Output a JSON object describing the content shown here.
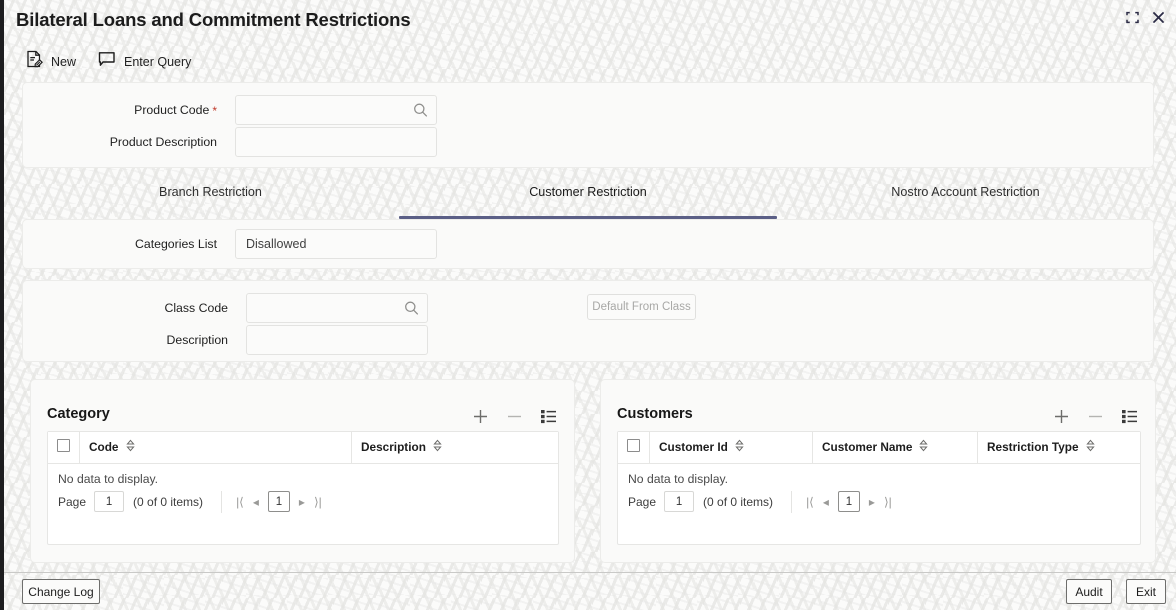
{
  "window": {
    "title": "Bilateral Loans and Commitment Restrictions",
    "restore_icon": "restore-down-icon",
    "close_icon": "close-icon"
  },
  "toolbar": {
    "items": [
      {
        "label": "New",
        "icon": "new-document-icon"
      },
      {
        "label": "Enter Query",
        "icon": "speech-bubble-icon"
      }
    ]
  },
  "product": {
    "code_label": "Product Code",
    "code_required": "*",
    "code_value": "",
    "code_lov_icon": "search-icon",
    "description_label": "Product Description",
    "description_value": ""
  },
  "tabs": [
    {
      "label": "Branch Restriction",
      "active": false
    },
    {
      "label": "Customer Restriction",
      "active": true
    },
    {
      "label": "Nostro Account Restriction",
      "active": false
    }
  ],
  "categories_list": {
    "label": "Categories List",
    "value": "Disallowed"
  },
  "class_section": {
    "class_code_label": "Class Code",
    "class_code_value": "",
    "class_code_lov_icon": "search-icon",
    "description_label": "Description",
    "description_value": "",
    "default_button_label": "Default From Class"
  },
  "grids": [
    {
      "title": "Category",
      "actions": [
        {
          "icon": "plus-icon",
          "name": "add-row-button"
        },
        {
          "icon": "minus-icon",
          "name": "delete-row-button"
        },
        {
          "icon": "list-detail-icon",
          "name": "single-view-button"
        }
      ],
      "select_all_checkbox": "",
      "columns": [
        {
          "label": "Code",
          "sort_icon": "sort-icon"
        },
        {
          "label": "Description",
          "sort_icon": "sort-icon"
        }
      ],
      "empty_message": "No data to display.",
      "pager": {
        "page_label": "Page",
        "page_value": "1",
        "count_text": "(0 of 0 items)",
        "first_icon": "|⟨",
        "prev_icon": "◂",
        "current_page": "1",
        "next_icon": "▸",
        "last_icon": "⟩|"
      }
    },
    {
      "title": "Customers",
      "actions": [
        {
          "icon": "plus-icon",
          "name": "add-row-button"
        },
        {
          "icon": "minus-icon",
          "name": "delete-row-button"
        },
        {
          "icon": "list-detail-icon",
          "name": "single-view-button"
        }
      ],
      "select_all_checkbox": "",
      "columns": [
        {
          "label": "Customer Id",
          "sort_icon": "sort-icon"
        },
        {
          "label": "Customer Name",
          "sort_icon": "sort-icon"
        },
        {
          "label": "Restriction Type",
          "sort_icon": "sort-icon"
        }
      ],
      "empty_message": "No data to display.",
      "pager": {
        "page_label": "Page",
        "page_value": "1",
        "count_text": "(0 of 0 items)",
        "first_icon": "|⟨",
        "prev_icon": "◂",
        "current_page": "1",
        "next_icon": "▸",
        "last_icon": "⟩|"
      }
    }
  ],
  "footer": {
    "change_log_label": "Change Log",
    "audit_label": "Audit",
    "exit_label": "Exit"
  },
  "colors": {
    "accent": "#5b5f86",
    "required_star": "#c0392b",
    "page_bg": "#fbfbfa",
    "card_bg": "#fafaf9",
    "border": "#ececea"
  }
}
